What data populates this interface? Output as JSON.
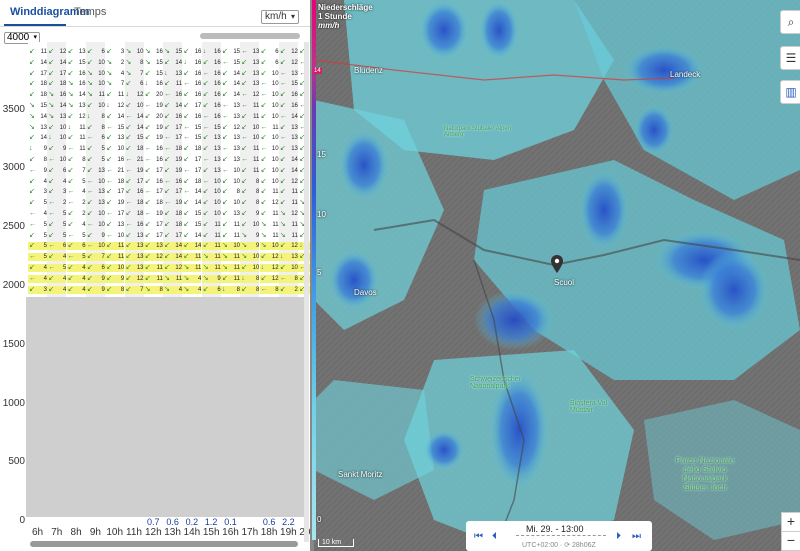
{
  "tabs": [
    {
      "label": "Winddiagramm",
      "active": true
    },
    {
      "label": "Temps",
      "active": false
    }
  ],
  "unit_select": {
    "value": "km/h"
  },
  "altitude_select": {
    "value": "4000"
  },
  "y_axis_labels": [
    "3500",
    "3000",
    "2500",
    "2000",
    "1500",
    "1000",
    "500",
    "0"
  ],
  "hours": [
    "6h",
    "7h",
    "8h",
    "9h",
    "10h",
    "11h",
    "12h",
    "13h",
    "14h",
    "15h",
    "16h",
    "17h",
    "18h",
    "19h",
    "20h"
  ],
  "rain": [
    "",
    "",
    "",
    "",
    "",
    "",
    "0.7",
    "0.6",
    "0.2",
    "1.2",
    "0.1",
    "",
    "0.6",
    "2.2",
    ""
  ],
  "wind_speeds": [
    [
      "11",
      "14",
      "17",
      "18",
      "18",
      "15",
      "14",
      "13",
      "14",
      "9",
      "8",
      "9",
      "4",
      "3",
      "5",
      "4",
      "5",
      "5",
      "5",
      "5",
      "4",
      "4",
      "3"
    ],
    [
      "12",
      "14",
      "17",
      "18",
      "16",
      "14",
      "13",
      "10",
      "10",
      "9",
      "10",
      "6",
      "4",
      "3",
      "2",
      "5",
      "5",
      "5",
      "6",
      "4",
      "5",
      "4",
      "4"
    ],
    [
      "13",
      "15",
      "16",
      "16",
      "14",
      "13",
      "12",
      "11",
      "11",
      "11",
      "8",
      "7",
      "5",
      "4",
      "2",
      "2",
      "4",
      "5",
      "6",
      "5",
      "4",
      "4",
      "4"
    ],
    [
      "6",
      "10",
      "10",
      "10",
      "11",
      "10",
      "8",
      "8",
      "6",
      "5",
      "5",
      "13",
      "10",
      "13",
      "13",
      "10",
      "10",
      "9",
      "10",
      "7",
      "6",
      "9",
      "9"
    ],
    [
      "3",
      "2",
      "4",
      "7",
      "11",
      "12",
      "14",
      "15",
      "13",
      "10",
      "16",
      "21",
      "18",
      "17",
      "19",
      "17",
      "13",
      "10",
      "11",
      "11",
      "10",
      "9",
      "8"
    ],
    [
      "10",
      "8",
      "7",
      "6",
      "12",
      "10",
      "14",
      "14",
      "15",
      "18",
      "21",
      "19",
      "17",
      "16",
      "18",
      "18",
      "16",
      "13",
      "13",
      "13",
      "13",
      "12",
      "7"
    ],
    [
      "16",
      "15",
      "15",
      "16",
      "20",
      "19",
      "20",
      "19",
      "19",
      "16",
      "16",
      "17",
      "16",
      "17",
      "18",
      "19",
      "17",
      "17",
      "13",
      "12",
      "11",
      "11",
      "8"
    ],
    [
      "15",
      "14",
      "13",
      "11",
      "16",
      "14",
      "16",
      "17",
      "17",
      "18",
      "19",
      "19",
      "16",
      "17",
      "19",
      "18",
      "18",
      "17",
      "14",
      "14",
      "12",
      "11",
      "4"
    ],
    [
      "16",
      "16",
      "16",
      "16",
      "16",
      "17",
      "16",
      "15",
      "15",
      "18",
      "17",
      "17",
      "18",
      "14",
      "14",
      "15",
      "15",
      "14",
      "14",
      "11",
      "11",
      "4",
      "4"
    ],
    [
      "16",
      "16",
      "16",
      "16",
      "16",
      "16",
      "16",
      "15",
      "13",
      "13",
      "13",
      "13",
      "10",
      "10",
      "10",
      "10",
      "11",
      "11",
      "11",
      "11",
      "11",
      "9",
      "6"
    ],
    [
      "15",
      "15",
      "14",
      "14",
      "14",
      "13",
      "13",
      "12",
      "13",
      "13",
      "13",
      "10",
      "10",
      "8",
      "10",
      "13",
      "11",
      "11",
      "10",
      "11",
      "11",
      "11",
      "8"
    ],
    [
      "13",
      "13",
      "13",
      "13",
      "12",
      "11",
      "11",
      "10",
      "10",
      "11",
      "11",
      "11",
      "8",
      "8",
      "8",
      "9",
      "10",
      "9",
      "9",
      "10",
      "10",
      "8",
      "8"
    ],
    [
      "6",
      "6",
      "10",
      "10",
      "10",
      "10",
      "10",
      "11",
      "10",
      "10",
      "10",
      "10",
      "10",
      "11",
      "12",
      "11",
      "11",
      "11",
      "10",
      "12",
      "12",
      "12",
      "8"
    ],
    [
      "12",
      "12",
      "13",
      "15",
      "16",
      "16",
      "14",
      "13",
      "13",
      "13",
      "14",
      "14",
      "12",
      "11",
      "11",
      "12",
      "11",
      "11",
      "12",
      "13",
      "10",
      "8",
      "2"
    ],
    [
      "11",
      "14",
      "16",
      "17",
      "17",
      "18",
      "18",
      "17",
      "16",
      "16",
      "16",
      "16",
      "14",
      "14",
      "14",
      "14",
      "13",
      "12",
      "12",
      "11",
      "10",
      "7",
      "3"
    ]
  ],
  "map": {
    "legend_title": "Niederschläge",
    "legend_subtitle": "1 Stunde",
    "legend_unit": "mm/h",
    "legend_values": [
      "15",
      "10",
      "5",
      "0"
    ],
    "legend_top_badge": "14",
    "places": [
      {
        "name": "Bludenz",
        "kind": "town"
      },
      {
        "name": "Landeck",
        "kind": "town"
      },
      {
        "name": "Naturpark Stubaier Alpen Arlberg",
        "kind": "park"
      },
      {
        "name": "Davos",
        "kind": "town"
      },
      {
        "name": "Scuol",
        "kind": "town"
      },
      {
        "name": "Schweizerischer Nationalpark",
        "kind": "park"
      },
      {
        "name": "Biosfera Val Müstair",
        "kind": "park"
      },
      {
        "name": "Sankt Moritz",
        "kind": "town"
      },
      {
        "name": "Parco Nazionale dello Stelvio Nationalpark Stilfser Joch",
        "kind": "park"
      }
    ],
    "scale_label": "10 km"
  },
  "timebar": {
    "time": "Mi. 29. - 13:00",
    "sub": "UTC+02:00 · ⟳ 28h06Z"
  }
}
